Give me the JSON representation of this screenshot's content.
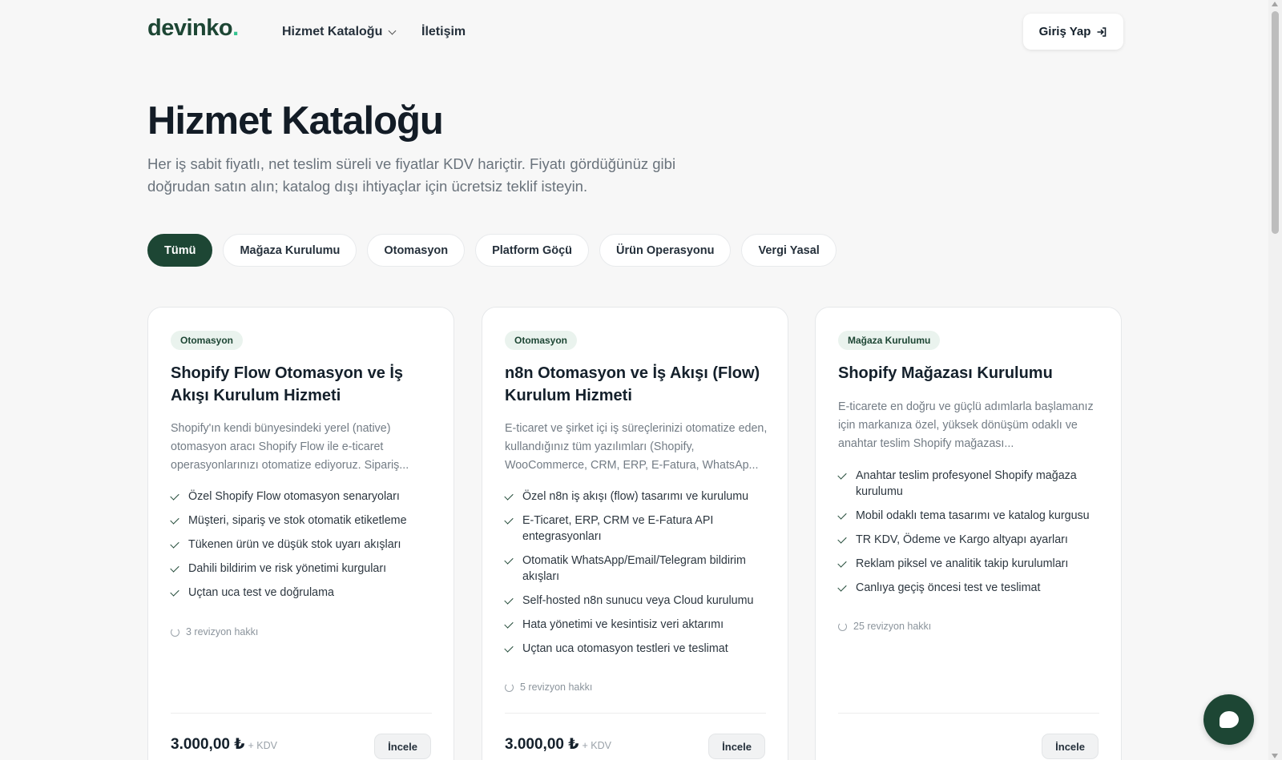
{
  "header": {
    "logo_text": "devinko",
    "logo_dot": ".",
    "nav": [
      {
        "label": "Hizmet Kataloğu",
        "has_dropdown": true
      },
      {
        "label": "İletişim"
      }
    ],
    "login_label": "Giriş Yap",
    "login_icon": "login-arrow-icon"
  },
  "hero": {
    "title": "Hizmet Kataloğu",
    "subtitle": "Her iş sabit fiyatlı, net teslim süreli ve fiyatlar KDV hariçtir. Fiyatı gördüğünüz gibi doğrudan satın alın; katalog dışı ihtiyaçlar için ücretsiz teklif isteyin."
  },
  "filters": [
    {
      "label": "Tümü",
      "active": true
    },
    {
      "label": "Mağaza Kurulumu"
    },
    {
      "label": "Otomasyon"
    },
    {
      "label": "Platform Göçü"
    },
    {
      "label": "Ürün Operasyonu"
    },
    {
      "label": "Vergi Yasal"
    }
  ],
  "cards": [
    {
      "tag": "Otomasyon",
      "title": "Shopify Flow Otomasyon ve İş Akışı Kurulum Hizmeti",
      "description": "Shopify'ın kendi bünyesindeki yerel (native) otomasyon aracı Shopify Flow ile e-ticaret operasyonlarınızı otomatize ediyoruz. Sipariş...",
      "features": [
        "Özel Shopify Flow otomasyon senaryoları",
        "Müşteri, sipariş ve stok otomatik etiketleme",
        "Tükenen ürün ve düşük stok uyarı akışları",
        "Dahili bildirim ve risk yönetimi kurguları",
        "Uçtan uca test ve doğrulama"
      ],
      "revision": "3 revizyon hakkı",
      "price": "3.000,00 ₺",
      "price_suffix": "+ KDV",
      "button": "İncele"
    },
    {
      "tag": "Otomasyon",
      "title": "n8n Otomasyon ve İş Akışı (Flow) Kurulum Hizmeti",
      "description": "E-ticaret ve şirket içi iş süreçlerinizi otomatize eden, kullandığınız tüm yazılımları (Shopify, WooCommerce, CRM, ERP, E-Fatura, WhatsAp...",
      "features": [
        "Özel n8n iş akışı (flow) tasarımı ve kurulumu",
        "E-Ticaret, ERP, CRM ve E-Fatura API entegrasyonları",
        "Otomatik WhatsApp/Email/Telegram bildirim akışları",
        "Self-hosted n8n sunucu veya Cloud kurulumu",
        "Hata yönetimi ve kesintisiz veri aktarımı",
        "Uçtan uca otomasyon testleri ve teslimat"
      ],
      "revision": "5 revizyon hakkı",
      "price": "3.000,00 ₺",
      "price_suffix": "+ KDV",
      "button": "İncele"
    },
    {
      "tag": "Mağaza Kurulumu",
      "title": "Shopify Mağazası Kurulumu",
      "description": "E-ticarete en doğru ve güçlü adımlarla başlamanız için markanıza özel, yüksek dönüşüm odaklı ve anahtar teslim Shopify mağazası...",
      "features": [
        "Anahtar teslim profesyonel Shopify mağaza kurulumu",
        "Mobil odaklı tema tasarımı ve katalog kurgusu",
        "TR KDV, Ödeme ve Kargo altyapı ayarları",
        "Reklam piksel ve analitik takip kurulumları",
        "Canlıya geçiş öncesi test ve teslimat"
      ],
      "revision": "25 revizyon hakkı",
      "price": "",
      "price_suffix": "",
      "button": "İncele"
    }
  ],
  "chat": {
    "icon": "chat-bubble-icon"
  }
}
